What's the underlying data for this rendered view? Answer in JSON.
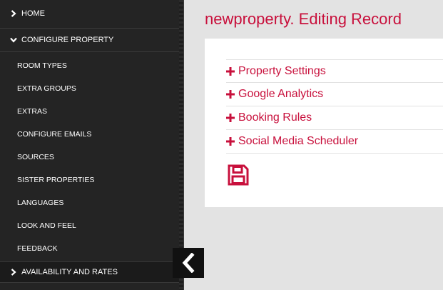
{
  "sidebar": {
    "home_label": "HOME",
    "configure_label": "CONFIGURE PROPERTY",
    "items": [
      {
        "label": "ROOM TYPES"
      },
      {
        "label": "EXTRA GROUPS"
      },
      {
        "label": "EXTRAS"
      },
      {
        "label": "CONFIGURE EMAILS"
      },
      {
        "label": "SOURCES"
      },
      {
        "label": "SISTER PROPERTIES"
      },
      {
        "label": "LANGUAGES"
      },
      {
        "label": "LOOK AND FEEL"
      },
      {
        "label": "FEEDBACK"
      }
    ],
    "availability_label": "AVAILABILITY AND RATES"
  },
  "page": {
    "title": "newproperty. Editing Record"
  },
  "sections": [
    {
      "label": "Property Settings"
    },
    {
      "label": "Google Analytics"
    },
    {
      "label": "Booking Rules"
    },
    {
      "label": "Social Media Scheduler"
    }
  ],
  "icons": {
    "chevron_right": "chevron-right-icon",
    "chevron_down": "chevron-down-icon",
    "plus": "plus-icon",
    "save": "save-icon",
    "collapse": "chevron-left-icon"
  },
  "colors": {
    "accent": "#c8103c",
    "sidebar_bg": "#242424",
    "page_bg": "#e3e3e3"
  }
}
